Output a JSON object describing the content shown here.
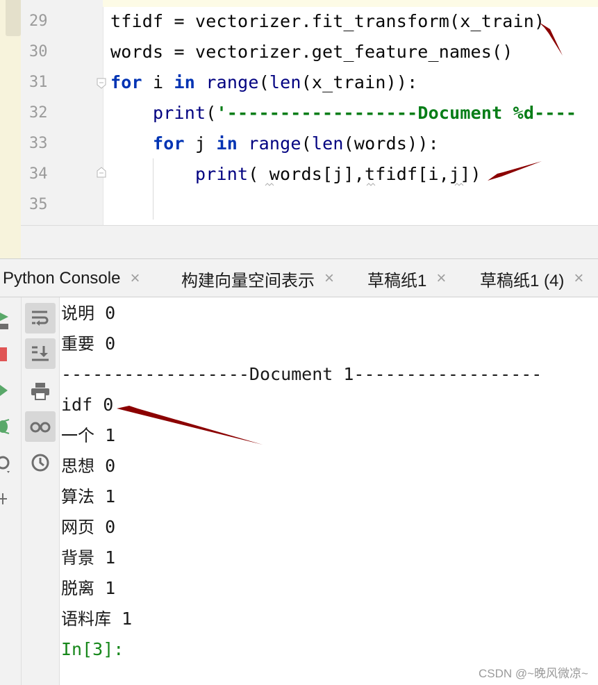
{
  "editor": {
    "lines": [
      {
        "num": "29",
        "code": "tfidf = vectorizer.fit_transform(x_train)"
      },
      {
        "num": "30",
        "code": "words = vectorizer.get_feature_names()"
      },
      {
        "num": "31",
        "code": "for i in range(len(x_train)):"
      },
      {
        "num": "32",
        "code": "    print('------------------Document %d----"
      },
      {
        "num": "33",
        "code": "    for j in range(len(words)):"
      },
      {
        "num": "34",
        "code": "        print( words[j],tfidf[i,j])"
      },
      {
        "num": "35",
        "code": ""
      }
    ]
  },
  "tabs": [
    {
      "label": "Python Console",
      "close": "×"
    },
    {
      "label": "构建向量空间表示",
      "close": "×"
    },
    {
      "label": "草稿纸1",
      "close": "×"
    },
    {
      "label": "草稿纸1 (4)",
      "close": "×"
    }
  ],
  "console": {
    "lines": [
      {
        "word": "说明",
        "value": "0"
      },
      {
        "word": "重要",
        "value": "0"
      },
      {
        "separator": "------------------Document 1------------------"
      },
      {
        "word": "idf",
        "value": "0"
      },
      {
        "word": "一个",
        "value": "1"
      },
      {
        "word": "思想",
        "value": "0"
      },
      {
        "word": "算法",
        "value": "1"
      },
      {
        "word": "网页",
        "value": "0"
      },
      {
        "word": "背景",
        "value": "1"
      },
      {
        "word": "脱离",
        "value": "1"
      },
      {
        "word": "语料库",
        "value": "1"
      }
    ],
    "prompt": "In[3]:"
  },
  "watermark": "CSDN @~晚风微凉~",
  "colors": {
    "keyword": "#0033b3",
    "builtin": "#000080",
    "string": "#067d17",
    "prompt": "#16871a",
    "annotation_arrow": "#8b0000"
  },
  "icons": {
    "run_toolbar": [
      "rerun-icon",
      "stop-icon",
      "run-icon",
      "debug-icon",
      "settings-icon",
      "add-icon"
    ],
    "console_toolbar": [
      "soft-wrap-icon",
      "scroll-to-end-icon",
      "print-icon",
      "show-variables-icon",
      "history-icon"
    ]
  }
}
